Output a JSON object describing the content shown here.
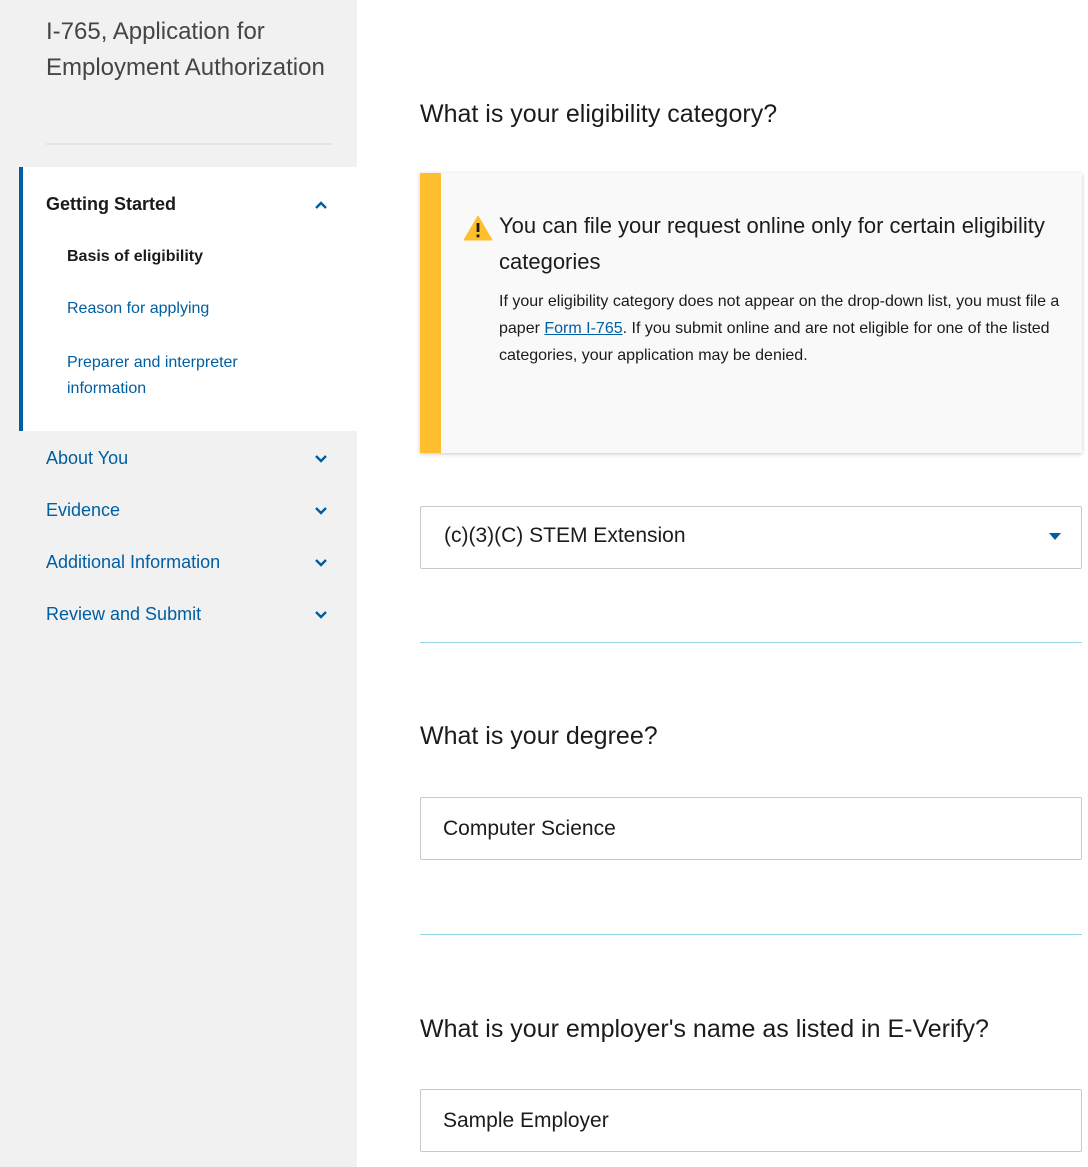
{
  "sidebar": {
    "form_title": "I-765, Application for Employment Authorization",
    "sections": [
      {
        "label": "Getting Started",
        "expanded": true,
        "items": [
          {
            "label": "Basis of eligibility",
            "active": true
          },
          {
            "label": "Reason for applying",
            "active": false
          },
          {
            "label": "Preparer and interpreter information",
            "active": false
          }
        ]
      },
      {
        "label": "About You",
        "expanded": false
      },
      {
        "label": "Evidence",
        "expanded": false
      },
      {
        "label": "Additional Information",
        "expanded": false
      },
      {
        "label": "Review and Submit",
        "expanded": false
      }
    ]
  },
  "main": {
    "eligibility": {
      "heading": "What is your eligibility category?",
      "alert": {
        "title": "You can file your request online only for certain eligibility categories",
        "text_before_link": "If your eligibility category does not appear on the drop-down list, you must file a paper ",
        "link_text": "Form I-765",
        "text_after_link": ". If you submit online and are not eligible for one of the listed categories, your application may be denied."
      },
      "selected_category": "(c)(3)(C) STEM Extension"
    },
    "degree": {
      "heading": "What is your degree?",
      "value": "Computer Science"
    },
    "employer": {
      "heading": "What is your employer's name as listed in E-Verify?",
      "value": "Sample Employer"
    }
  },
  "colors": {
    "accent": "#005ea2",
    "warning": "#ffbe2e",
    "sidebar_bg": "#f1f1f1",
    "divider": "#97d4ea"
  },
  "icons": {
    "warning": "warning-triangle-icon",
    "expand": "chevron-down-icon",
    "collapse": "chevron-up-icon",
    "dropdown": "caret-down-icon"
  }
}
